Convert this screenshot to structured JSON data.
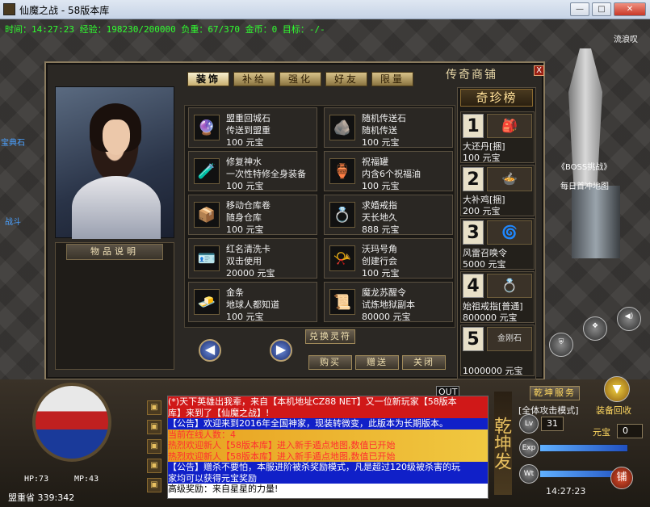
{
  "window": {
    "title": "仙魔之战 - 58版本库",
    "minimize": "—",
    "maximize": "□",
    "close": "✕"
  },
  "status_bar": "时间：14:27:23 经验：198230/200000 负重：67/370 金币：0 目标：-/-",
  "world": {
    "npc_right_name": "流浪叹",
    "boss_label": "《BOSS挑战》",
    "boss_sub": "每日首冲地图",
    "left_npc_a": "宝典石",
    "left_npc_b": "战斗"
  },
  "shop": {
    "title": "传奇商铺",
    "close": "X",
    "tabs": [
      "装饰",
      "补给",
      "强化",
      "好友",
      "限量"
    ],
    "item_desc_label": "物品说明",
    "items": [
      {
        "icon": "🔮",
        "name": "盟重回城石",
        "desc": "传送到盟重",
        "price": "100 元宝"
      },
      {
        "icon": "🪨",
        "name": "随机传送石",
        "desc": "随机传送",
        "price": "100 元宝"
      },
      {
        "icon": "🧪",
        "name": "修复神水",
        "desc": "一次性特修全身装备",
        "price": "100 元宝"
      },
      {
        "icon": "🏺",
        "name": "祝福罐",
        "desc": "内含6个祝福油",
        "price": "100 元宝"
      },
      {
        "icon": "📦",
        "name": "移动仓库卷",
        "desc": "随身仓库",
        "price": "100 元宝"
      },
      {
        "icon": "💍",
        "name": "求婚戒指",
        "desc": "天长地久",
        "price": "888 元宝"
      },
      {
        "icon": "🪪",
        "name": "红名清洗卡",
        "desc": "双击使用",
        "price": "20000 元宝"
      },
      {
        "icon": "📯",
        "name": "沃玛号角",
        "desc": "创建行会",
        "price": "100 元宝"
      },
      {
        "icon": "🧈",
        "name": "金条",
        "desc": "地球人都知道",
        "price": "100 元宝"
      },
      {
        "icon": "📜",
        "name": "魔龙苏醒令",
        "desc": "试炼地狱副本",
        "price": "80000 元宝"
      }
    ],
    "exchange_button": "兑换灵符",
    "buy_button": "购买",
    "gift_button": "赠送",
    "close_button": "关闭",
    "prev": "◀",
    "next": "▶",
    "rank_title": "奇珍榜",
    "rank": [
      {
        "num": "1",
        "icon": "🎒",
        "name": "大还丹[捆]",
        "price": "100 元宝"
      },
      {
        "num": "2",
        "icon": "🍲",
        "name": "大补鸡[捆]",
        "price": "200 元宝"
      },
      {
        "num": "3",
        "icon": "🌀",
        "name": "风雷召唤令",
        "price": "5000 元宝"
      },
      {
        "num": "4",
        "icon": "💍",
        "name": "始祖戒指[普通]",
        "price": "800000 元宝"
      },
      {
        "num": "5",
        "icon": "金刚石",
        "name": "",
        "price": "1000000 元宝"
      }
    ]
  },
  "hud": {
    "hp": "HP:73",
    "mp": "MP:43",
    "location": "盟重省 339:342",
    "out_label": "OUT",
    "chat": [
      {
        "cls": "m1",
        "text": "(*)天下英雄出我辈，来自【本机地址CZ88 NET】又一位新玩家【58版本"
      },
      {
        "cls": "m1",
        "text": "库】来到了【仙魔之战】!"
      },
      {
        "cls": "m2",
        "text": "【公告】欢迎来到2016年全国神家，现装转微变，此版本为长期版本。"
      },
      {
        "cls": "m3",
        "text": "当前在线人数：4"
      },
      {
        "cls": "m3",
        "text": "热烈欢迎新人【58版本库】进入新手遁点地图,数值已开始"
      },
      {
        "cls": "m3",
        "text": "热烈欢迎新人【58版本库】进入新手遁点地图,数值已开始"
      },
      {
        "cls": "m2",
        "text": "【公告】赠杀不要怕，本服进阶被杀奖励模式，凡是超过120级被杀害的玩"
      },
      {
        "cls": "m2",
        "text": "家均可以获得元宝奖励"
      },
      {
        "cls": "m4",
        "text": "高级奖励：来自星星的力量!"
      }
    ],
    "banner": "乾坤发",
    "qiankun_service": "乾坤服务",
    "attack_mode": "[全体攻击模式]",
    "equip_recycle": "装备回收",
    "lv_label": "Lv",
    "level": "31",
    "exp_label": "Exp",
    "wt_label": "Wt",
    "yuanbao_label": "元宝",
    "yuanbao_value": "0",
    "clock": "14:27:23",
    "shop_btn": "铺"
  }
}
